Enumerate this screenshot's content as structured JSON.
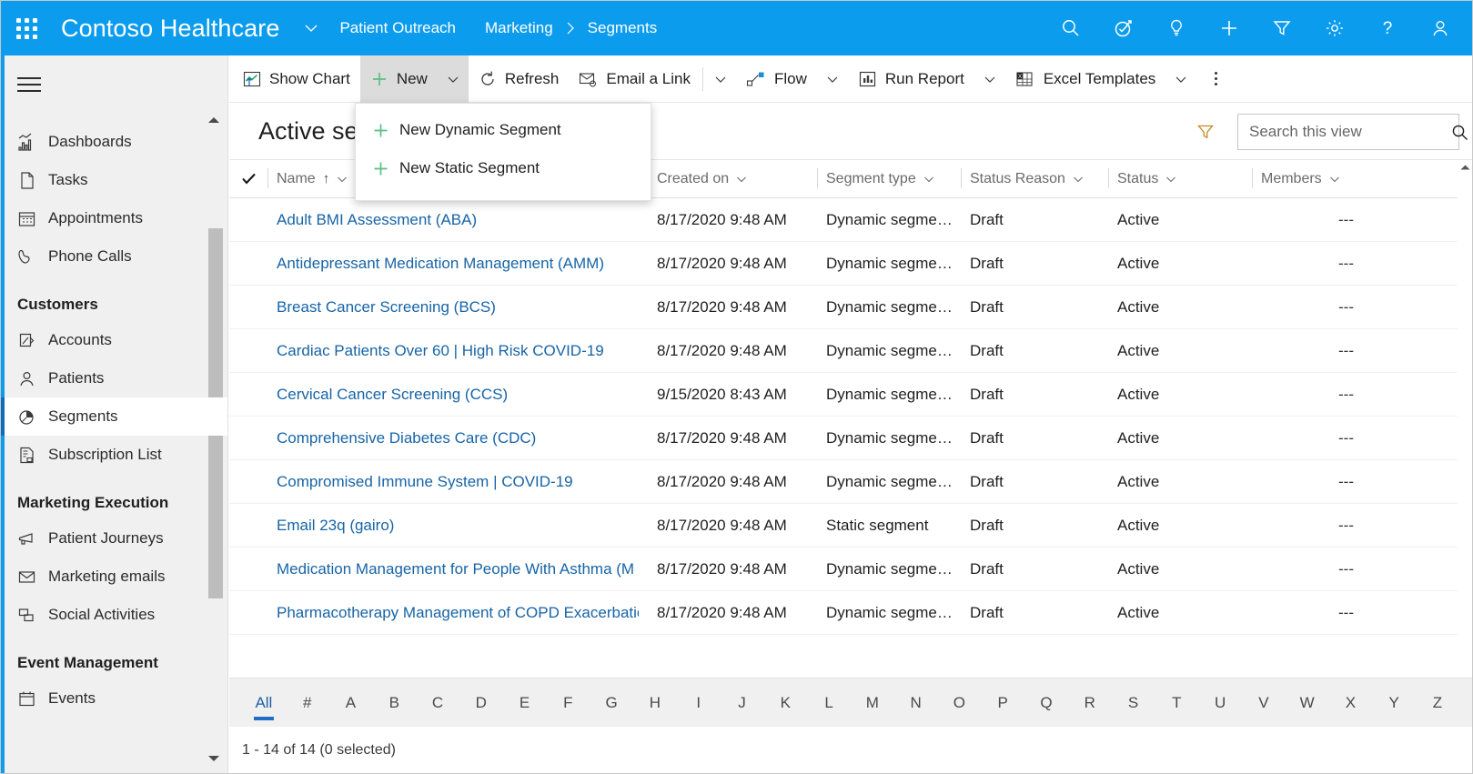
{
  "topbar": {
    "waffle_name": "app-launcher",
    "brand": "Contoso Healthcare",
    "app_name": "Patient Outreach",
    "breadcrumb": [
      "Marketing",
      "Segments"
    ],
    "actions": [
      {
        "name": "search-icon",
        "label": "Search"
      },
      {
        "name": "assistant-icon",
        "label": "Assistant"
      },
      {
        "name": "lightbulb-icon",
        "label": "Insights"
      },
      {
        "name": "quick-create-icon",
        "label": "Quick Create"
      },
      {
        "name": "filter-icon",
        "label": "Filter"
      },
      {
        "name": "settings-gear-icon",
        "label": "Settings"
      },
      {
        "name": "help-icon",
        "label": "Help"
      },
      {
        "name": "user-avatar-icon",
        "label": "User"
      }
    ],
    "bg_color": "#0c9ced"
  },
  "sidebar": {
    "hamburger_label": "Site Map",
    "groups": [
      {
        "title": "",
        "items": [
          {
            "label": "Dashboards",
            "icon": "dashboards-icon",
            "selected": false
          },
          {
            "label": "Tasks",
            "icon": "tasks-icon",
            "selected": false
          },
          {
            "label": "Appointments",
            "icon": "calendar-icon",
            "selected": false
          },
          {
            "label": "Phone Calls",
            "icon": "phone-icon",
            "selected": false
          }
        ]
      },
      {
        "title": "Customers",
        "items": [
          {
            "label": "Accounts",
            "icon": "accounts-icon",
            "selected": false
          },
          {
            "label": "Patients",
            "icon": "person-icon",
            "selected": false
          },
          {
            "label": "Segments",
            "icon": "segments-pie-icon",
            "selected": true
          },
          {
            "label": "Subscription List",
            "icon": "subscription-list-icon",
            "selected": false
          }
        ]
      },
      {
        "title": "Marketing Execution",
        "items": [
          {
            "label": "Patient Journeys",
            "icon": "megaphone-icon",
            "selected": false
          },
          {
            "label": "Marketing emails",
            "icon": "envelope-icon",
            "selected": false
          },
          {
            "label": "Social Activities",
            "icon": "social-posts-icon",
            "selected": false
          }
        ]
      },
      {
        "title": "Event Management",
        "items": [
          {
            "label": "Events",
            "icon": "events-calendar-icon",
            "selected": false
          }
        ]
      }
    ],
    "selected_accent": "#0f6cbd"
  },
  "commandbar": {
    "items": [
      {
        "label": "Show Chart",
        "icon": "show-chart-icon",
        "has_caret": false,
        "active": false
      },
      {
        "label": "New",
        "icon": "plus-icon",
        "has_caret": true,
        "active": true
      },
      {
        "label": "Refresh",
        "icon": "refresh-icon",
        "has_caret": false,
        "active": false
      },
      {
        "label": "Email a Link",
        "icon": "email-link-icon",
        "has_caret": false,
        "active": false
      }
    ],
    "email_caret": true,
    "items2": [
      {
        "label": "Flow",
        "icon": "flow-icon",
        "has_caret": true
      },
      {
        "label": "Run Report",
        "icon": "run-report-icon",
        "has_caret": true
      },
      {
        "label": "Excel Templates",
        "icon": "excel-icon",
        "has_caret": true
      }
    ],
    "overflow_label": "More commands"
  },
  "new_menu": {
    "open": true,
    "items": [
      {
        "label": "New Dynamic Segment",
        "icon": "plus-icon"
      },
      {
        "label": "New Static Segment",
        "icon": "plus-icon"
      }
    ],
    "plus_color": "#5bbf84"
  },
  "view": {
    "title": "Active seg",
    "title_full": "Active segments",
    "filter_label": "Edit filters",
    "search": {
      "placeholder": "Search this view",
      "value": ""
    }
  },
  "grid": {
    "select_all_label": "Select all",
    "columns": [
      {
        "key": "name",
        "label": "Name",
        "sorted": "asc"
      },
      {
        "key": "createdon",
        "label": "Created on",
        "sorted": ""
      },
      {
        "key": "segmenttype",
        "label": "Segment type",
        "sorted": ""
      },
      {
        "key": "statusreason",
        "label": "Status Reason",
        "sorted": ""
      },
      {
        "key": "status",
        "label": "Status",
        "sorted": ""
      },
      {
        "key": "members",
        "label": "Members",
        "sorted": ""
      }
    ],
    "rows": [
      {
        "name": "Adult BMI Assessment (ABA)",
        "createdon": "8/17/2020 9:48 AM",
        "segmenttype": "Dynamic segme…",
        "statusreason": "Draft",
        "status": "Active",
        "members": "---"
      },
      {
        "name": "Antidepressant Medication Management (AMM)",
        "createdon": "8/17/2020 9:48 AM",
        "segmenttype": "Dynamic segme…",
        "statusreason": "Draft",
        "status": "Active",
        "members": "---"
      },
      {
        "name": "Breast Cancer Screening (BCS)",
        "createdon": "8/17/2020 9:48 AM",
        "segmenttype": "Dynamic segme…",
        "statusreason": "Draft",
        "status": "Active",
        "members": "---"
      },
      {
        "name": "Cardiac Patients Over 60 | High Risk COVID-19",
        "createdon": "8/17/2020 9:48 AM",
        "segmenttype": "Dynamic segme…",
        "statusreason": "Draft",
        "status": "Active",
        "members": "---"
      },
      {
        "name": "Cervical Cancer Screening (CCS)",
        "createdon": "9/15/2020 8:43 AM",
        "segmenttype": "Dynamic segme…",
        "statusreason": "Draft",
        "status": "Active",
        "members": "---"
      },
      {
        "name": "Comprehensive Diabetes Care (CDC)",
        "createdon": "8/17/2020 9:48 AM",
        "segmenttype": "Dynamic segme…",
        "statusreason": "Draft",
        "status": "Active",
        "members": "---"
      },
      {
        "name": "Compromised Immune System | COVID-19",
        "createdon": "8/17/2020 9:48 AM",
        "segmenttype": "Dynamic segme…",
        "statusreason": "Draft",
        "status": "Active",
        "members": "---"
      },
      {
        "name": "Email 23q (gairo)",
        "createdon": "8/17/2020 9:48 AM",
        "segmenttype": "Static segment",
        "statusreason": "Draft",
        "status": "Active",
        "members": "---"
      },
      {
        "name": "Medication Management for People With Asthma (M",
        "createdon": "8/17/2020 9:48 AM",
        "segmenttype": "Dynamic segme…",
        "statusreason": "Draft",
        "status": "Active",
        "members": "---"
      },
      {
        "name": "Pharmacotherapy Management of COPD Exacerbatio",
        "createdon": "8/17/2020 9:48 AM",
        "segmenttype": "Dynamic segme…",
        "statusreason": "Draft",
        "status": "Active",
        "members": "---"
      }
    ]
  },
  "alphabar": {
    "active": "All",
    "letters": [
      "All",
      "#",
      "A",
      "B",
      "C",
      "D",
      "E",
      "F",
      "G",
      "H",
      "I",
      "J",
      "K",
      "L",
      "M",
      "N",
      "O",
      "P",
      "Q",
      "R",
      "S",
      "T",
      "U",
      "V",
      "W",
      "X",
      "Y",
      "Z"
    ],
    "active_color": "#1f6fc4"
  },
  "statusbar": {
    "record_count": "1 - 14 of 14 (0 selected)"
  }
}
